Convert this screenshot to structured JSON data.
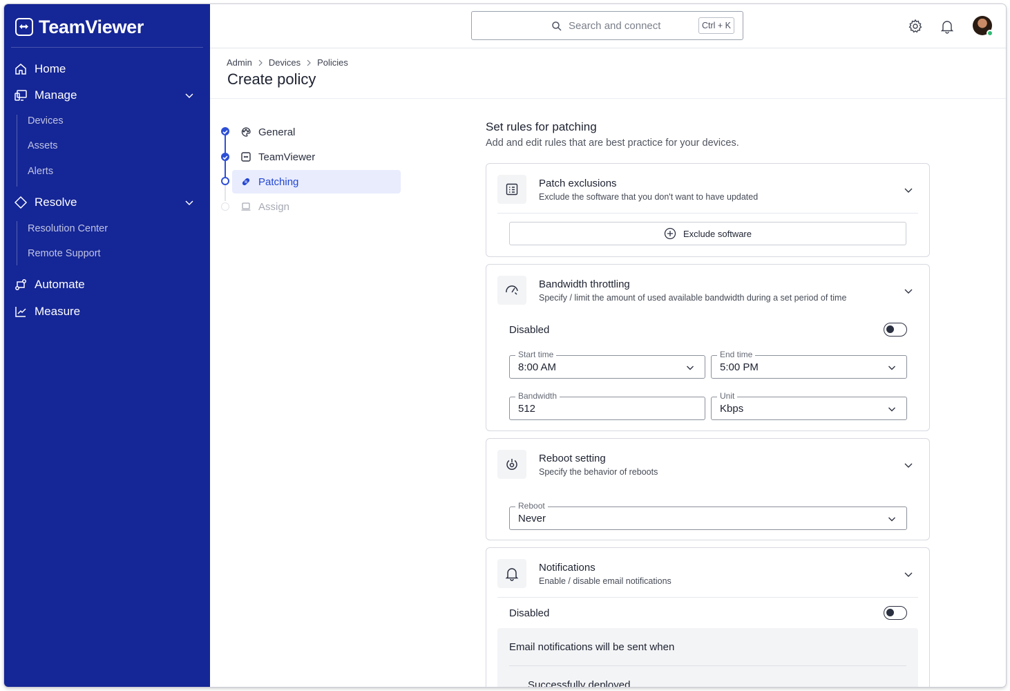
{
  "brand": {
    "name": "TeamViewer",
    "primary": "#152696",
    "accent": "#2446d1"
  },
  "sidebar": {
    "items": [
      {
        "label": "Home",
        "icon": "home-icon"
      },
      {
        "label": "Manage",
        "icon": "monitor-icon",
        "expanded": true,
        "children": [
          "Devices",
          "Assets",
          "Alerts"
        ]
      },
      {
        "label": "Resolve",
        "icon": "diamond-icon",
        "expanded": true,
        "children": [
          "Resolution Center",
          "Remote Support"
        ]
      },
      {
        "label": "Automate",
        "icon": "automate-icon"
      },
      {
        "label": "Measure",
        "icon": "chart-icon"
      }
    ]
  },
  "topbar": {
    "search_placeholder": "Search and connect",
    "search_shortcut": "Ctrl + K",
    "icons": [
      "settings-icon",
      "bell-icon",
      "avatar"
    ]
  },
  "breadcrumb": [
    "Admin",
    "Devices",
    "Policies"
  ],
  "page_title": "Create policy",
  "stepper": {
    "steps": [
      {
        "label": "General",
        "state": "done"
      },
      {
        "label": "TeamViewer",
        "state": "done"
      },
      {
        "label": "Patching",
        "state": "active"
      },
      {
        "label": "Assign",
        "state": "upcoming"
      }
    ]
  },
  "section": {
    "title": "Set rules for patching",
    "subtitle": "Add and edit rules that are best practice for your devices."
  },
  "cards": {
    "exclusions": {
      "title": "Patch exclusions",
      "desc": "Exclude the software that you don't want to have updated",
      "button": "Exclude software"
    },
    "bandwidth": {
      "title": "Bandwidth throttling",
      "desc": "Specify / limit the amount of used available bandwidth during a set period of time",
      "toggle_label": "Disabled",
      "enabled": false,
      "start_label": "Start time",
      "start_value": "8:00 AM",
      "end_label": "End time",
      "end_value": "5:00 PM",
      "bw_label": "Bandwidth",
      "bw_value": "512",
      "unit_label": "Unit",
      "unit_value": "Kbps"
    },
    "reboot": {
      "title": "Reboot setting",
      "desc": "Specify the behavior of reboots",
      "field_label": "Reboot",
      "field_value": "Never"
    },
    "notifications": {
      "title": "Notifications",
      "desc": "Enable / disable email notifications",
      "toggle_label": "Disabled",
      "enabled": false,
      "email_title": "Email notifications will be sent when",
      "email_items": [
        "Successfully deployed"
      ]
    }
  }
}
